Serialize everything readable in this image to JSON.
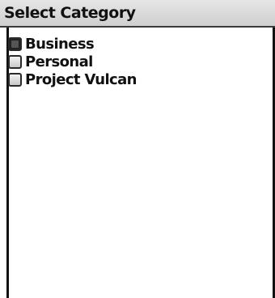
{
  "screen": {
    "title": "Select Category"
  },
  "categories": [
    {
      "label": "Business",
      "checked": true
    },
    {
      "label": "Personal",
      "checked": false
    },
    {
      "label": "Project Vulcan",
      "checked": false
    }
  ]
}
